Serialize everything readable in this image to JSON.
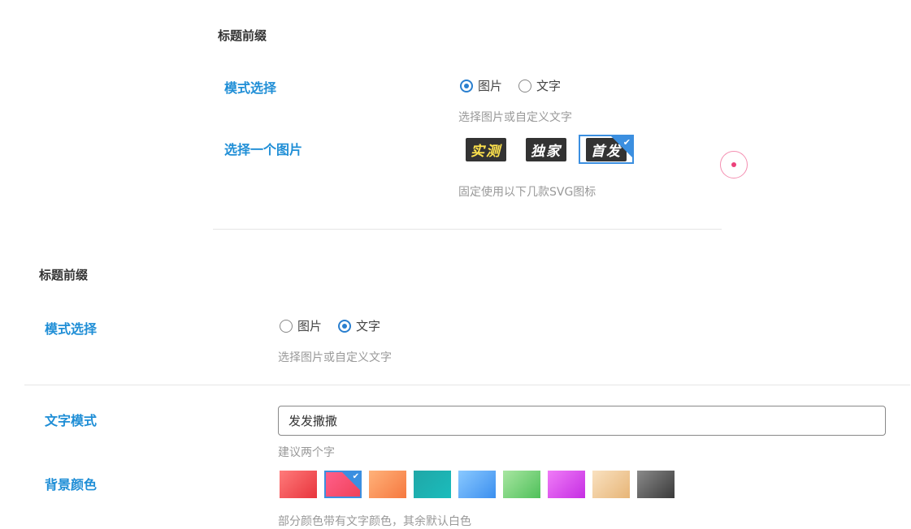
{
  "top_panel": {
    "section_title": "标题前缀",
    "mode_label": "模式选择",
    "mode_options": [
      "图片",
      "文字"
    ],
    "mode_selected": "图片",
    "mode_hint": "选择图片或自定义文字",
    "image_label": "选择一个图片",
    "image_options": [
      "实测",
      "独家",
      "首发"
    ],
    "image_selected": "首发",
    "image_hint": "固定使用以下几款SVG图标"
  },
  "bottom_panel": {
    "section_title": "标题前缀",
    "mode_label": "模式选择",
    "mode_options": [
      "图片",
      "文字"
    ],
    "mode_selected": "文字",
    "mode_hint": "选择图片或自定义文字",
    "text_label": "文字模式",
    "text_value": "发发撒撒",
    "text_hint": "建议两个字",
    "bg_label": "背景颜色",
    "bg_hint": "部分颜色带有文字颜色，其余默认白色",
    "bg_swatches": [
      {
        "from": "#ff7b7b",
        "to": "#e8343c"
      },
      {
        "from": "#ff5f8a",
        "to": "#f0425a"
      },
      {
        "from": "#ffb27a",
        "to": "#f6783f"
      },
      {
        "from": "#20a7a7",
        "to": "#1abcbc"
      },
      {
        "from": "#8ac9ff",
        "to": "#3b8fef"
      },
      {
        "from": "#a8e6a1",
        "to": "#4fc05a"
      },
      {
        "from": "#f07cf7",
        "to": "#c52ee3"
      },
      {
        "from": "#f9e1c0",
        "to": "#e7b577"
      },
      {
        "from": "#8a8a8a",
        "to": "#3a3a3a"
      }
    ],
    "bg_selected_index": 1
  },
  "colors": {
    "accent": "#1f8ed6",
    "select_border": "#3b8fe0",
    "hint": "#999999",
    "divider": "#e5e5e5"
  },
  "icons": {
    "check": "check-icon",
    "cursor": "cursor-indicator-icon"
  }
}
